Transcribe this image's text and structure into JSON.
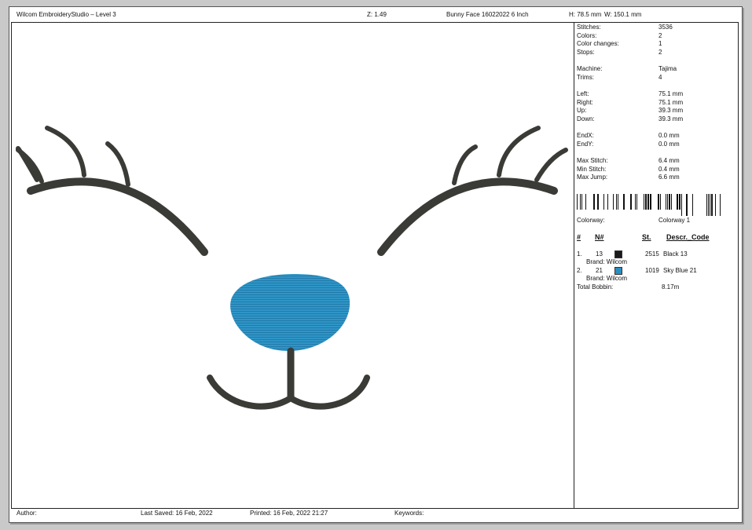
{
  "header": {
    "app_title": "Wilcom EmbroideryStudio – Level 3",
    "zoom": "Z: 1.49",
    "design_name": "Bunny Face 16022022 6 Inch",
    "height": "H: 78.5 mm",
    "width": "W: 150.1 mm"
  },
  "stats": [
    {
      "label": "Stitches:",
      "value": "3536"
    },
    {
      "label": "Colors:",
      "value": "2"
    },
    {
      "label": "Color changes:",
      "value": "1"
    },
    {
      "label": "Stops:",
      "value": "2"
    },
    {
      "label": "Machine:",
      "value": "Tajima"
    },
    {
      "label": "Trims:",
      "value": "4"
    },
    {
      "label": "Left:",
      "value": "75.1 mm"
    },
    {
      "label": "Right:",
      "value": "75.1 mm"
    },
    {
      "label": "Up:",
      "value": "39.3 mm"
    },
    {
      "label": "Down:",
      "value": "39.3 mm"
    },
    {
      "label": "EndX:",
      "value": "0.0 mm"
    },
    {
      "label": "EndY:",
      "value": "0.0 mm"
    },
    {
      "label": "Max Stitch:",
      "value": "6.4 mm"
    },
    {
      "label": "Min Stitch:",
      "value": "0.4 mm"
    },
    {
      "label": "Max Jump:",
      "value": "6.6 mm"
    }
  ],
  "colorway": {
    "label": "Colorway:",
    "value": "Colorway 1"
  },
  "color_table": {
    "headers": {
      "index": "#",
      "number": "N#",
      "stitches": "St.",
      "description": "Descr._Code"
    },
    "rows": [
      {
        "index": "1.",
        "number": "13",
        "swatch_color": "#1a1a1a",
        "stitches": "2515",
        "description": "Black 13",
        "brand": "Brand: Wilcom"
      },
      {
        "index": "2.",
        "number": "21",
        "swatch_color": "#2b8cbf",
        "stitches": "1019",
        "description": "Sky Blue 21",
        "brand": "Brand: Wilcom"
      }
    ],
    "total_bobbin_label": "Total Bobbin:",
    "total_bobbin_value": "8.17m"
  },
  "footer": {
    "author": "Author:",
    "last_saved": "Last Saved: 16 Feb, 2022",
    "printed": "Printed: 16 Feb, 2022 21:27",
    "keywords": "Keywords:"
  },
  "colors": {
    "thread_dark": "#3a3b36",
    "thread_blue": "#2f95c7"
  }
}
